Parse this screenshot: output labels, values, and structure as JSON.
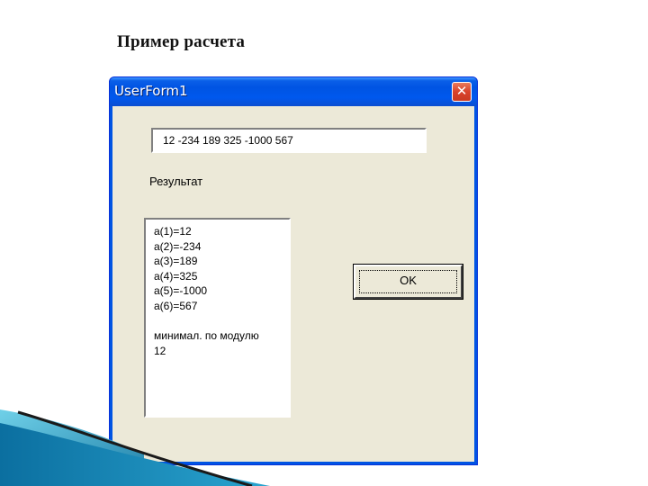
{
  "slide": {
    "title": "Пример расчета"
  },
  "window": {
    "title": "UserForm1",
    "close_symbol": "✕",
    "input_value": "12 -234 189 325 -1000 567",
    "result_label": "Результат",
    "result_lines": [
      "a(1)=12",
      "a(2)=-234",
      "a(3)=189",
      "a(4)=325",
      "a(5)=-1000",
      "a(6)=567",
      "",
      "минимал. по модулю",
      "12"
    ],
    "ok_label": "OK"
  },
  "icons": {
    "close": "close-icon"
  },
  "colors": {
    "titlebar": "#0054e3",
    "client": "#ece9d8",
    "close_button": "#d9422b"
  }
}
